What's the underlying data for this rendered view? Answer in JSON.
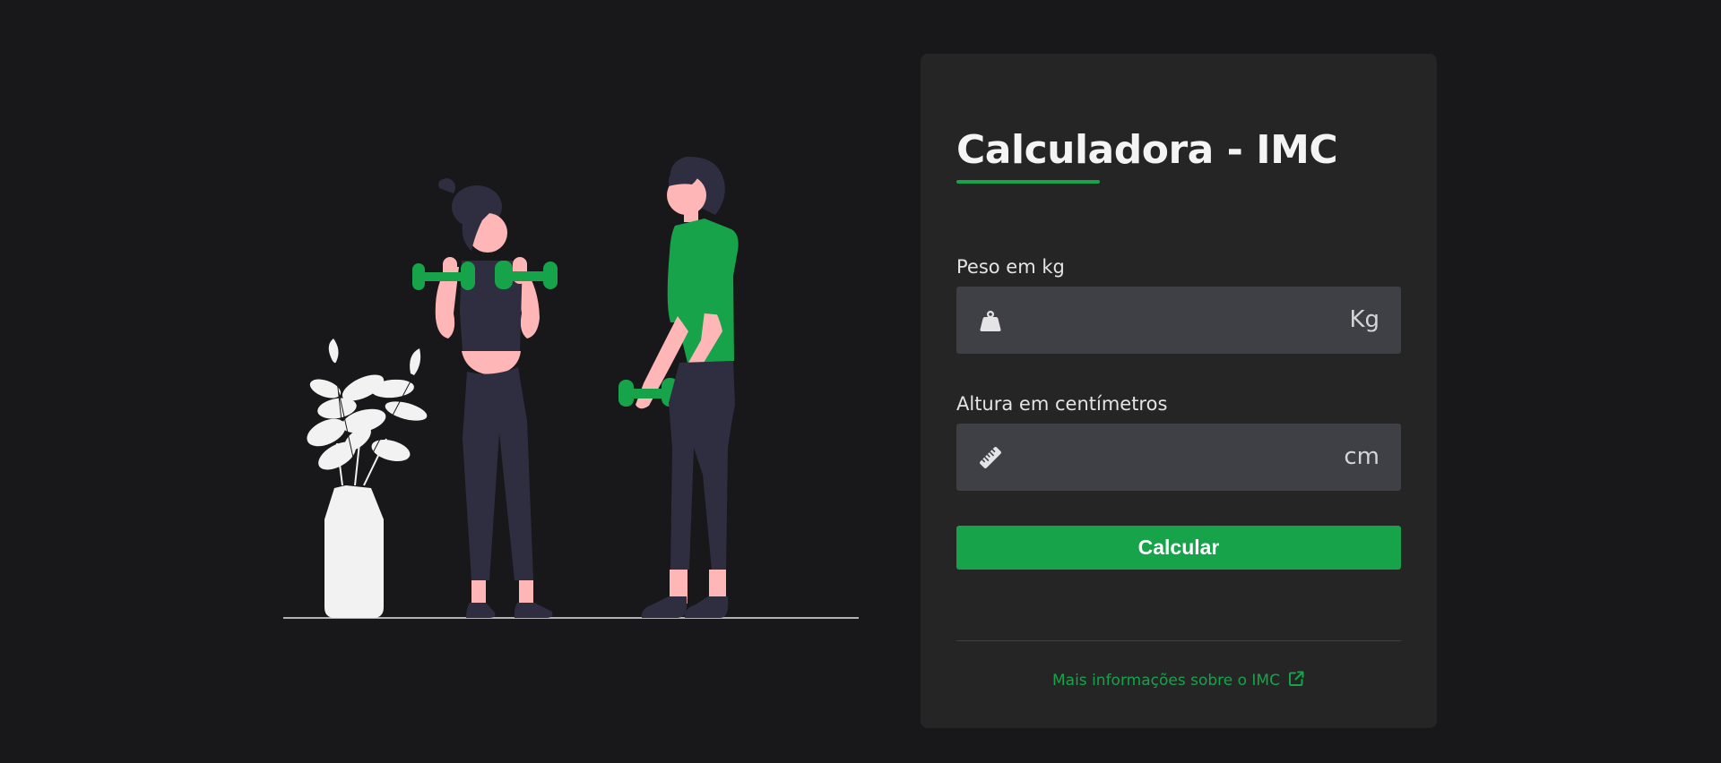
{
  "card": {
    "title": "Calculadora - IMC",
    "weight": {
      "label": "Peso em kg",
      "value": "",
      "unit": "Kg",
      "icon": "weight-icon"
    },
    "height": {
      "label": "Altura em centímetros",
      "value": "",
      "unit": "cm",
      "icon": "ruler-icon"
    },
    "button_label": "Calcular",
    "more_info_link": "Mais informações sobre o IMC",
    "link_icon": "external-link-icon"
  },
  "illustration": {
    "name": "fitness-illustration"
  },
  "colors": {
    "background": "#18181b",
    "card": "#252525",
    "accent": "#16a34a",
    "input": "#3f3f46",
    "text": "#f4f4f5",
    "skin": "#ffb6b6",
    "clothing_dark": "#2f2e41",
    "plant": "#f2f2f2"
  }
}
